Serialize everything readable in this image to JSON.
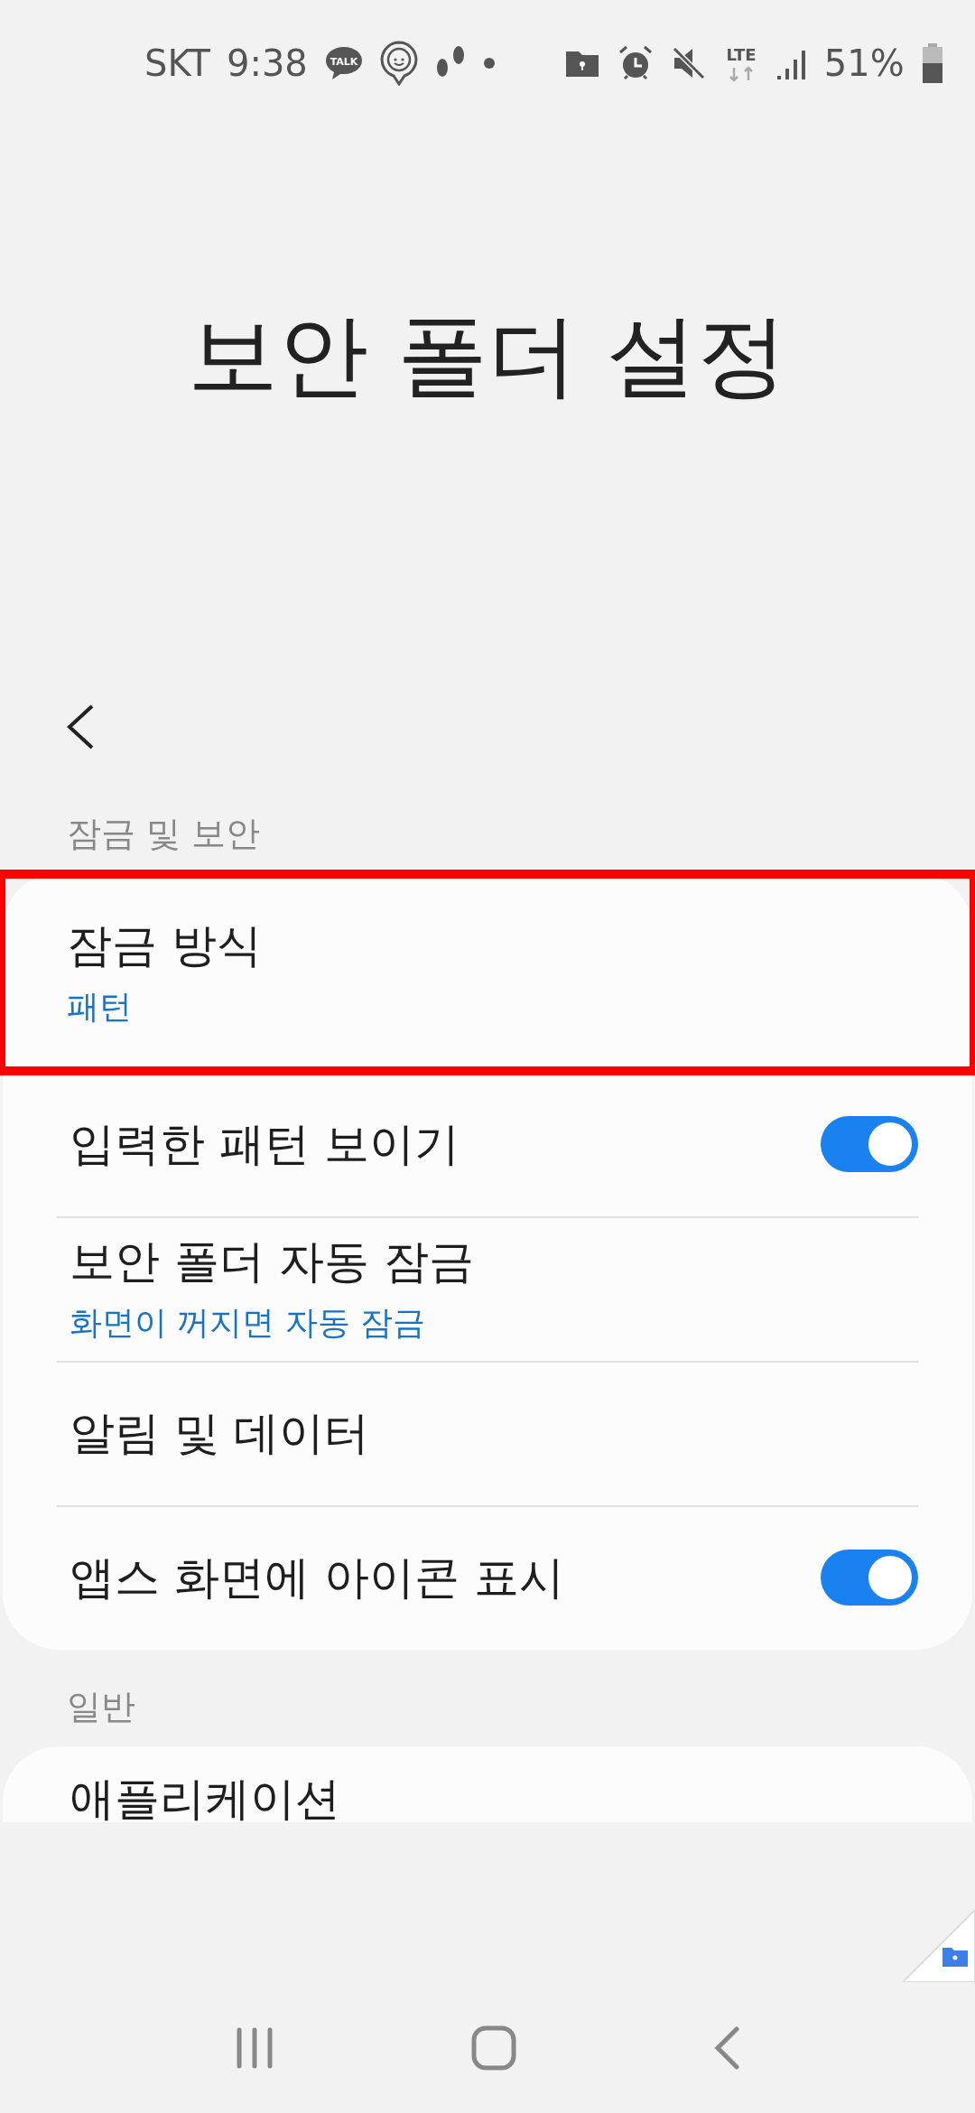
{
  "status_bar": {
    "carrier": "SKT",
    "time": "9:38",
    "talk_badge": "TALK",
    "network": "LTE",
    "battery": "51%"
  },
  "title": "보안 폴더 설정",
  "sections": [
    {
      "header": "잠금 및 보안",
      "items": [
        {
          "kind": "value",
          "title": "잠금 방식",
          "subtitle": "패턴",
          "highlighted": true
        },
        {
          "kind": "toggle",
          "title": "입력한 패턴 보이기",
          "on": true,
          "highlighted": false
        },
        {
          "kind": "value",
          "title": "보안 폴더 자동 잠금",
          "subtitle": "화면이 꺼지면 자동 잠금",
          "highlighted": false
        },
        {
          "kind": "plain",
          "title": "알림 및 데이터",
          "highlighted": false
        },
        {
          "kind": "toggle",
          "title": "앱스 화면에 아이콘 표시",
          "on": true,
          "highlighted": false
        }
      ]
    },
    {
      "header": "일반",
      "items": [
        {
          "kind": "plain",
          "title": "애플리케이션",
          "highlighted": false
        }
      ]
    }
  ]
}
